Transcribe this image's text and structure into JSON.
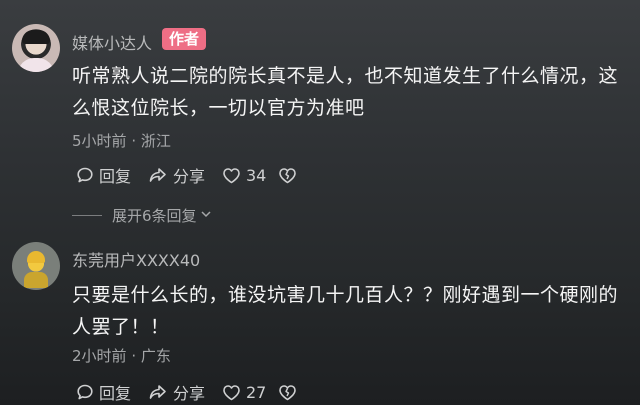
{
  "comments": [
    {
      "username": "媒体小达人",
      "badge": "作者",
      "text": "听常熟人说二院的院长真不是人，也不知道发生了什么情况，这么恨这位院长，一切以官方为准吧",
      "time": "5小时前",
      "separator": "·",
      "location": "浙江",
      "reply_label": "回复",
      "share_label": "分享",
      "like_count": "34",
      "expand_label": "展开6条回复"
    },
    {
      "username": "东莞用户XXXX40",
      "text": "只要是什么长的，谁没坑害几十几百人？？刚好遇到一个硬刚的人罢了！！",
      "time": "2小时前",
      "separator": "·",
      "location": "广东",
      "reply_label": "回复",
      "share_label": "分享",
      "like_count": "27"
    }
  ],
  "colors": {
    "background": "#2f3235",
    "badge": "#ee6e85",
    "primary_text": "#f5f5f5",
    "secondary_text": "#a5a7a9"
  },
  "icons": [
    "comment-icon",
    "share-icon",
    "heart-icon",
    "broken-heart-icon",
    "chevron-down-icon"
  ]
}
